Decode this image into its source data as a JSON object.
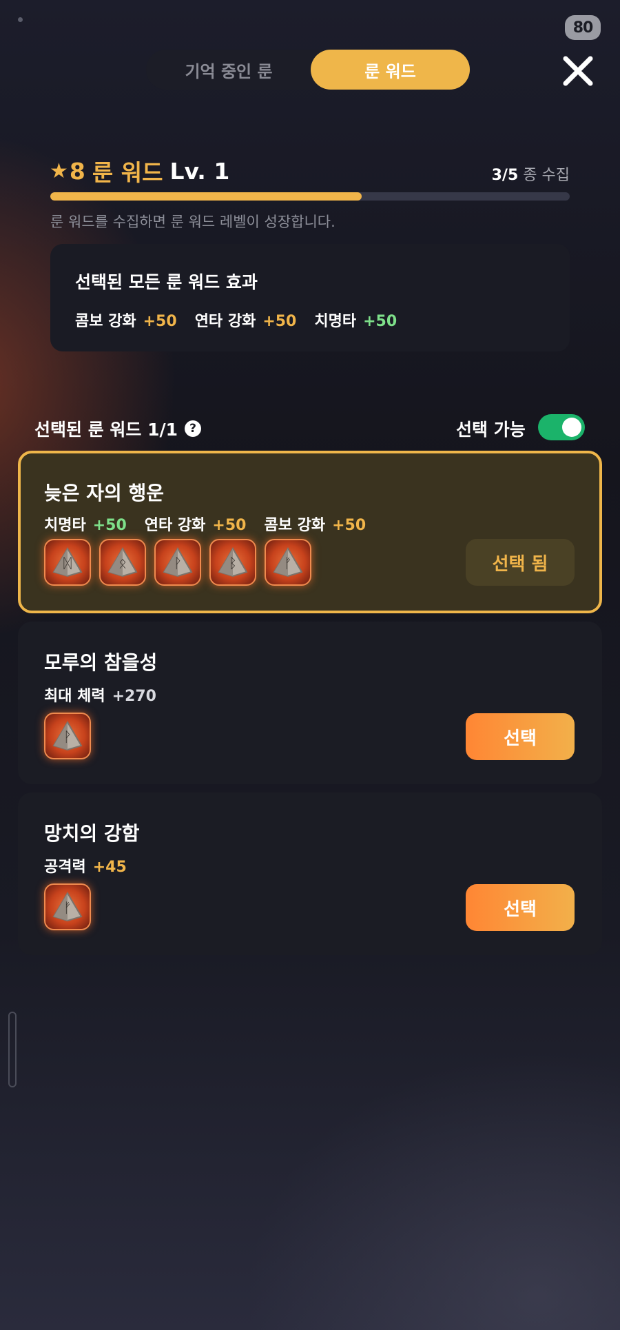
{
  "status": {
    "battery": "80"
  },
  "tabs": [
    {
      "label": "기억 중인 룬",
      "active": false
    },
    {
      "label": "룬 워드",
      "active": true
    }
  ],
  "header": {
    "star_level": "8",
    "title": "룬 워드",
    "level": "Lv. 1",
    "collected": "3",
    "total": "5",
    "collect_suffix": "종 수집",
    "progress": 0.6,
    "hint": "룬 워드를 수집하면 룬 워드 레벨이 성장합니다."
  },
  "effects": {
    "title": "선택된 모든 룬 워드 효과",
    "items": [
      {
        "label": "콤보 강화",
        "value": "+50",
        "color": "#f1b54a"
      },
      {
        "label": "연타 강화",
        "value": "+50",
        "color": "#f1b54a"
      },
      {
        "label": "치명타",
        "value": "+50",
        "color": "#7ee08a"
      }
    ]
  },
  "selection": {
    "label": "선택된 룬 워드 1/1",
    "available_label": "선택 가능",
    "toggle_on": true
  },
  "cards": [
    {
      "name": "늦은 자의 행운",
      "stats": [
        {
          "label": "치명타",
          "value": "+50",
          "color": "#7ee08a"
        },
        {
          "label": "연타 강화",
          "value": "+50",
          "color": "#f1b54a"
        },
        {
          "label": "콤보 강화",
          "value": "+50",
          "color": "#f1b54a"
        }
      ],
      "runes": [
        "rune-icon",
        "rune-icon",
        "rune-icon",
        "rune-icon",
        "rune-icon"
      ],
      "button": "선택 됨",
      "selected": true
    },
    {
      "name": "모루의 참을성",
      "stats": [
        {
          "label": "최대 체력",
          "value": "+270",
          "color": "#d9dae0"
        }
      ],
      "runes": [
        "rune-icon"
      ],
      "button": "선택",
      "selected": false
    },
    {
      "name": "망치의 강함",
      "stats": [
        {
          "label": "공격력",
          "value": "+45",
          "color": "#f1b54a"
        }
      ],
      "runes": [
        "rune-icon"
      ],
      "button": "선택",
      "selected": false
    }
  ]
}
